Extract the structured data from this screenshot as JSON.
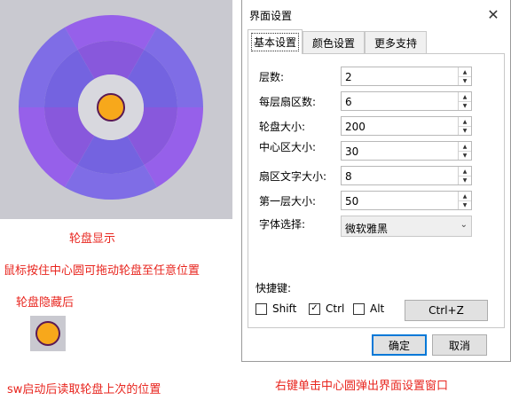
{
  "preview": {
    "caption_show": "轮盘显示",
    "caption_drag": "鼠标按住中心圆可拖动轮盘至任意位置",
    "caption_hidden": "轮盘隐藏后",
    "caption_sw": "sw启动后读取轮盘上次的位置",
    "caption_rightclick": "右键单击中心圆弹出界面设置窗口",
    "colors": {
      "outer_a": "#9660ea",
      "outer_b": "#7f6de6",
      "inner_a": "#8858dc",
      "inner_b": "#7463e0",
      "center_ring": "#d8d8de",
      "center_dot": "#f7a81b",
      "center_dot_border": "#5a1a54",
      "background": "#c9c9d0"
    }
  },
  "dialog": {
    "title": "界面设置",
    "close_icon": "close-icon",
    "tabs": [
      {
        "label": "基本设置",
        "active": true
      },
      {
        "label": "颜色设置",
        "active": false
      },
      {
        "label": "更多支持",
        "active": false
      }
    ],
    "fields": [
      {
        "label": "层数:",
        "value": "2"
      },
      {
        "label": "每层扇区数:",
        "value": "6"
      },
      {
        "label": "轮盘大小:",
        "value": "200"
      },
      {
        "label": "中心区大小:",
        "value": "30"
      },
      {
        "label": "扇区文字大小:",
        "value": "8"
      },
      {
        "label": "第一层大小:",
        "value": "50"
      }
    ],
    "font_label": "字体选择:",
    "font_value": "微软雅黑",
    "hotkey_label": "快捷键:",
    "hotkeys": [
      {
        "label": "Shift",
        "checked": false
      },
      {
        "label": "Ctrl",
        "checked": true
      },
      {
        "label": "Alt",
        "checked": false
      }
    ],
    "hotkey_button": "Ctrl+Z",
    "ok_label": "确定",
    "cancel_label": "取消"
  }
}
